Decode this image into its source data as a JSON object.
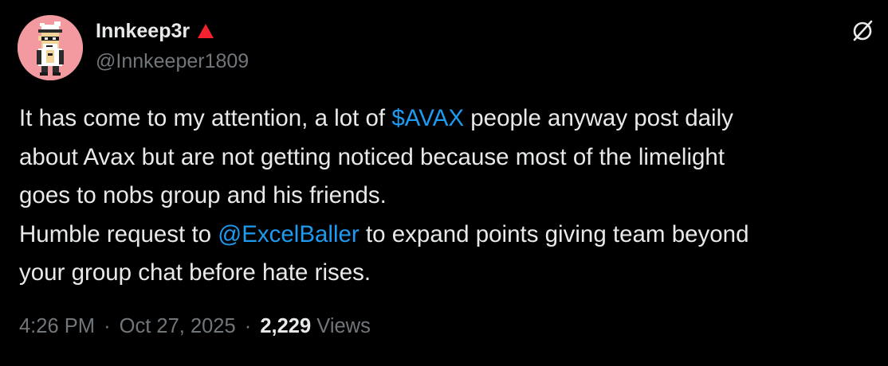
{
  "author": {
    "display_name": "Innkeep3r",
    "handle": "@Innkeeper1809",
    "badge_icon": "red-triangle-icon",
    "badge_color": "#f4212e"
  },
  "menu": {
    "icon": "grok-slash-circle-icon"
  },
  "tweet": {
    "line1_pre": "It has come to my attention, a lot of ",
    "line1_cashtag": "$AVAX",
    "line1_post": " people anyway post daily",
    "line2": "about Avax but are not getting noticed because most of the limelight",
    "line3": "goes to nobs group and his friends.",
    "line4_pre": "Humble request to ",
    "line4_mention": "@ExcelBaller",
    "line4_post": " to expand points giving team beyond",
    "line5": "your group chat before hate rises."
  },
  "meta": {
    "time": "4:26 PM",
    "date": "Oct 27, 2025",
    "separator": "·",
    "views_count": "2,229",
    "views_label": "Views"
  },
  "colors": {
    "background": "#000000",
    "text": "#e7e9ea",
    "secondary": "#71767b",
    "link": "#1d9bf0",
    "avatar_bg": "#f29aa0"
  }
}
